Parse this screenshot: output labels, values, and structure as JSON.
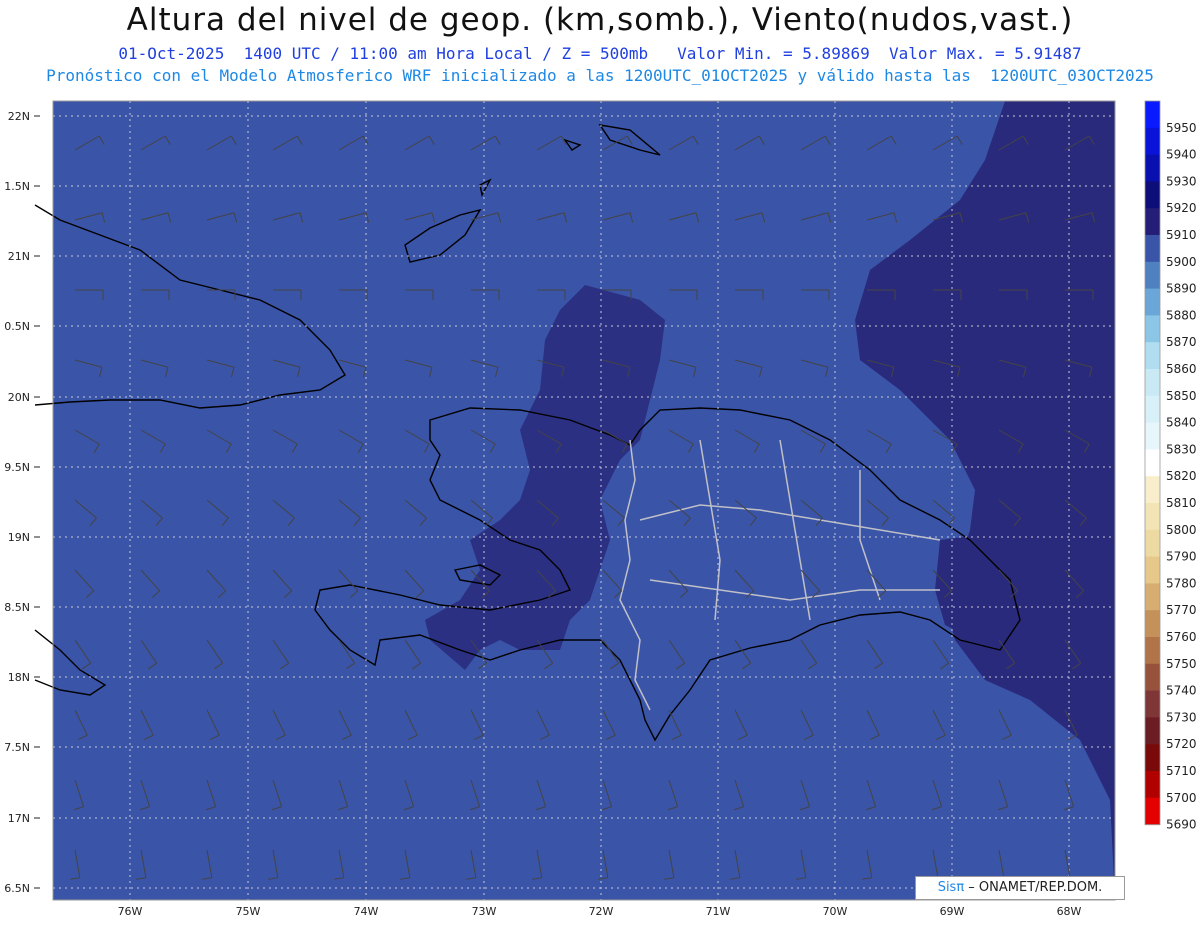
{
  "title": "Altura del nivel de geop. (km,somb.), Viento(nudos,vast.)",
  "subtitle": "01-Oct-2025  1400 UTC / 11:00 am Hora Local / Z = 500mb   Valor Min. = 5.89869  Valor Max. = 5.91487",
  "subtitle2": "Pronóstico con el Modelo Atmosferico WRF inicializado a las 1200UTC_01OCT2025 y válido hasta las  1200UTC_03OCT2025",
  "credit": {
    "brand": "Sisπ",
    "text": " – ONAMET/REP.DOM."
  },
  "lat_labels": [
    "22N",
    "1.5N",
    "21N",
    "0.5N",
    "20N",
    "9.5N",
    "19N",
    "8.5N",
    "18N",
    "7.5N",
    "17N",
    "6.5N"
  ],
  "lon_labels": [
    "76W",
    "75W",
    "74W",
    "73W",
    "72W",
    "71W",
    "70W",
    "69W",
    "68W"
  ],
  "colorbar": {
    "labels": [
      "5950",
      "5940",
      "5930",
      "5920",
      "5910",
      "5900",
      "5890",
      "5880",
      "5870",
      "5860",
      "5850",
      "5840",
      "5830",
      "5820",
      "5810",
      "5800",
      "5790",
      "5780",
      "5770",
      "5760",
      "5750",
      "5740",
      "5730",
      "5720",
      "5710",
      "5700",
      "5690"
    ],
    "colors": [
      "#0a1aff",
      "#0a14d8",
      "#0a0fb0",
      "#0d0e7a",
      "#241e78",
      "#3a54a8",
      "#4f81c0",
      "#6aa6d8",
      "#8cc6e6",
      "#b0def0",
      "#c9eaf5",
      "#d8f1f8",
      "#e6f6fb",
      "#ffffff",
      "#f8eecb",
      "#f3e4b6",
      "#edd9a2",
      "#e5c88a",
      "#d8ad72",
      "#c5915b",
      "#b07448",
      "#97523c",
      "#7e3636",
      "#6c1d24",
      "#7a0a0a",
      "#b00000",
      "#e40000"
    ]
  },
  "colors": {
    "ocean_land_fill": "#3a54a8",
    "high_contour": "#2a2a7c",
    "gridline": "#c8c8d8",
    "border": "#c0c0c8"
  }
}
